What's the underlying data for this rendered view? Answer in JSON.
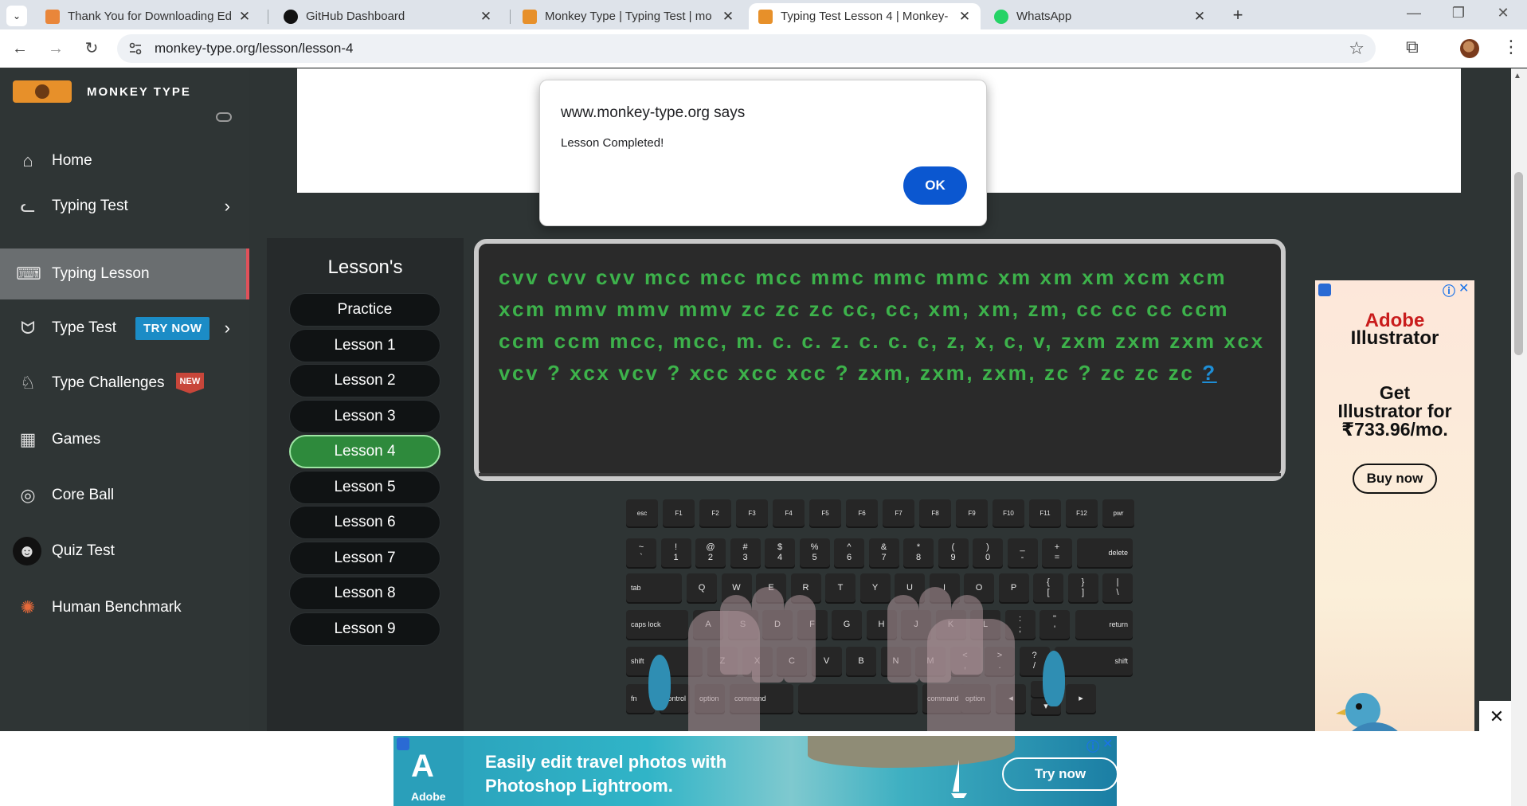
{
  "browser": {
    "tabs": [
      {
        "title": "Thank You for Downloading Ed",
        "favicon_color": "#e9863a"
      },
      {
        "title": "GitHub Dashboard",
        "favicon_color": "#111111"
      },
      {
        "title": "Monkey Type | Typing Test | mo",
        "favicon_color": "#e7902a"
      },
      {
        "title": "Typing Test Lesson 4 | Monkey-",
        "favicon_color": "#e7902a"
      },
      {
        "title": "WhatsApp",
        "favicon_color": "#25d366"
      }
    ],
    "url": "monkey-type.org/lesson/lesson-4"
  },
  "sidebar": {
    "brand": "MONKEY TYPE",
    "items": [
      {
        "label": "Home",
        "icon": "home-icon"
      },
      {
        "label": "Typing Test",
        "icon": "cat-icon"
      },
      {
        "label": "Typing Lesson",
        "icon": "keyboard-icon"
      },
      {
        "label": "Type Test",
        "icon": "fox-icon",
        "badge": "TRY NOW"
      },
      {
        "label": "Type Challenges",
        "icon": "award-icon",
        "badge": "NEW"
      },
      {
        "label": "Games",
        "icon": "grid-icon"
      },
      {
        "label": "Core Ball",
        "icon": "target-icon"
      },
      {
        "label": "Quiz Test",
        "icon": "quiz-icon"
      },
      {
        "label": "Human Benchmark",
        "icon": "brain-icon"
      }
    ]
  },
  "lessons": {
    "title": "Lesson's",
    "items": [
      "Practice",
      "Lesson 1",
      "Lesson 2",
      "Lesson 3",
      "Lesson 4",
      "Lesson 5",
      "Lesson 6",
      "Lesson 7",
      "Lesson 8",
      "Lesson 9"
    ],
    "active": "Lesson 4"
  },
  "typing": {
    "text": "cvv cvv cvv mcc mcc mcc mmc mmc mmc xm xm xm xcm xcm xcm mmv mmv mmv zc zc zc cc, cc, xm, xm, zm, cc cc cc ccm ccm ccm mcc, mcc, m. c. c. z. c. c. c, z, x, c, v, zxm zxm zxm xcx vcv ? xcx vcv ? xcc xcc xcc ? zxm, zxm, zxm, zc ? zc zc zc",
    "cursor_char": "?"
  },
  "keyboard": {
    "fn_row": [
      "esc",
      "F1",
      "F2",
      "F3",
      "F4",
      "F5",
      "F6",
      "F7",
      "F8",
      "F9",
      "F10",
      "F11",
      "F12",
      "pwr"
    ],
    "num_row": [
      "~\n`",
      "!\n1",
      "@\n2",
      "#\n3",
      "$\n4",
      "%\n5",
      "^\n6",
      "&\n7",
      "*\n8",
      "(\n9",
      ")\n0",
      "_\n-",
      "+\n="
    ],
    "delete": "delete",
    "tab": "tab",
    "q_row": [
      "Q",
      "W",
      "E",
      "R",
      "T",
      "Y",
      "U",
      "I",
      "O",
      "P",
      "{\n[",
      "}\n]",
      "|\n\\"
    ],
    "caps": "caps lock",
    "a_row": [
      "A",
      "S",
      "D",
      "F",
      "G",
      "H",
      "J",
      "K",
      "L",
      ":\n;",
      "\"\n'"
    ],
    "return": "return",
    "shift": "shift",
    "z_row": [
      "Z",
      "X",
      "C",
      "V",
      "B",
      "N",
      "M",
      "<\n,",
      ">\n.",
      "?\n/"
    ],
    "bottom_row": [
      "fn",
      "control",
      "option",
      "command",
      "command",
      "option"
    ]
  },
  "dialog": {
    "title": "www.monkey-type.org says",
    "message": "Lesson Completed!",
    "ok": "OK"
  },
  "side_ad": {
    "brand_line1": "Adobe",
    "brand_line2": "Illustrator",
    "headline": "Get\nIllustrator for\n₹733.96/mo.",
    "cta": "Buy now"
  },
  "bottom_ad": {
    "brand": "Adobe",
    "headline_line1": "Easily edit travel photos with",
    "headline_line2": "Photoshop Lightroom.",
    "cta": "Try now"
  }
}
